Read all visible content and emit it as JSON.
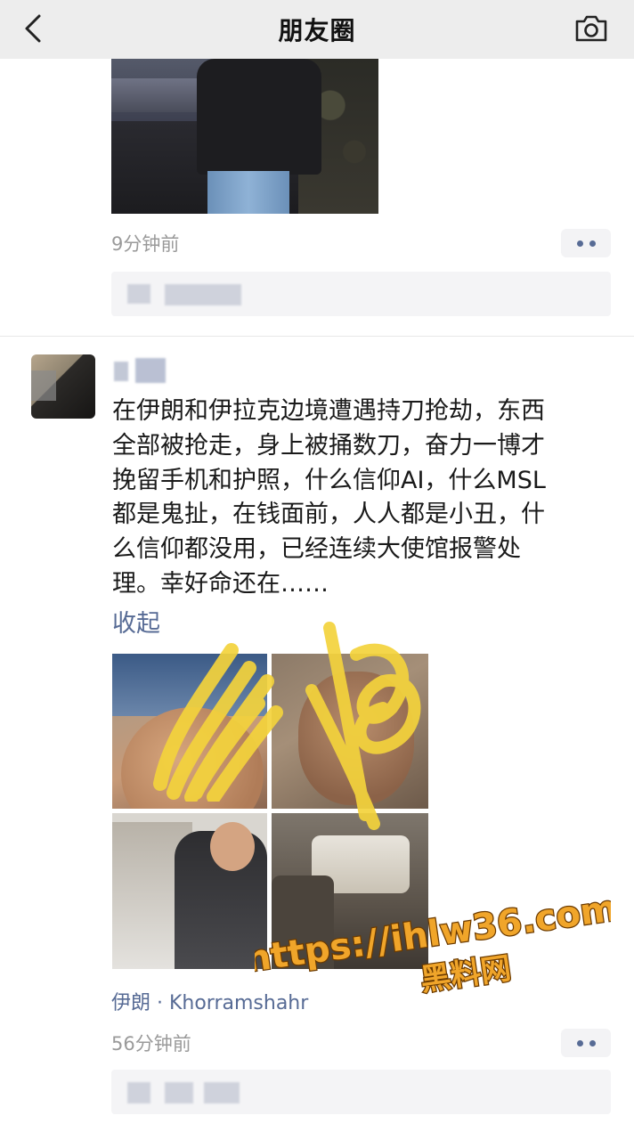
{
  "nav": {
    "title": "朋友圈"
  },
  "icons": {
    "back": "chevron-left-icon",
    "camera": "camera-icon",
    "more": "more-dots-icon"
  },
  "colors": {
    "link": "#576b95",
    "meta": "#9a9a9a",
    "nav_bg": "#ededed",
    "scribble": "#f3d23c",
    "watermark": "#f0a52a"
  },
  "prev_post": {
    "time": "9分钟前"
  },
  "post": {
    "text": "在伊朗和伊拉克边境遭遇持刀抢劫，东西\n全部被抢走，身上被捅数刀，奋力一博才\n挽留手机和护照，什么信仰AI，什么MSL\n都是鬼扯，在钱面前，人人都是小丑，什\n么信仰都没用，已经连续大使馆报警处\n理。幸好命还在……",
    "collapse": "收起",
    "location": "伊朗 · Khorramshahr",
    "time": "56分钟前"
  },
  "watermark": {
    "url": "https://ihlw36.com",
    "name": "黑料网"
  }
}
